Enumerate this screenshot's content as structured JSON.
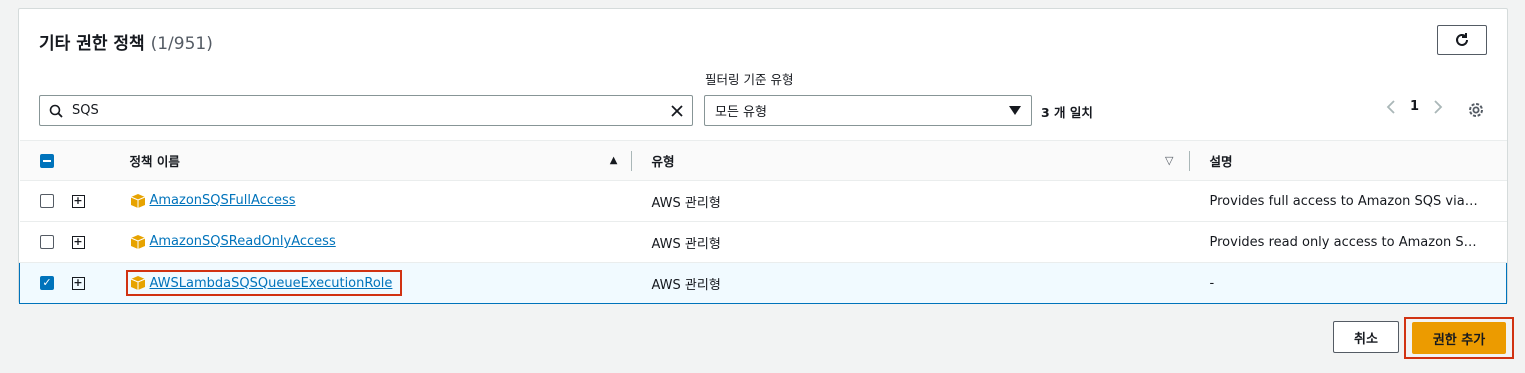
{
  "header": {
    "title": "기타 권한 정책",
    "count": "(1/951)"
  },
  "filter": {
    "label": "필터링 기준 유형",
    "search_value": "SQS",
    "type_selected": "모든 유형",
    "match_count": "3 개 일치"
  },
  "pagination": {
    "current_page": "1"
  },
  "table": {
    "columns": {
      "name": "정책 이름",
      "type": "유형",
      "description": "설명"
    },
    "rows": [
      {
        "name": "AmazonSQSFullAccess",
        "type": "AWS 관리형",
        "description": "Provides full access to Amazon SQS via the AWS Management Console.",
        "checked": false
      },
      {
        "name": "AmazonSQSReadOnlyAccess",
        "type": "AWS 관리형",
        "description": "Provides read only access to Amazon SQS via the AWS Management Console.",
        "checked": false
      },
      {
        "name": "AWSLambdaSQSQueueExecutionRole",
        "type": "AWS 관리형",
        "description": "-",
        "checked": true
      }
    ]
  },
  "footer": {
    "cancel_label": "취소",
    "add_label": "권한 추가"
  },
  "colors": {
    "accent": "#ec9b00",
    "link": "#0073bb",
    "highlight_border": "#d13212",
    "policy_icon": "#e7a300"
  },
  "icons": {
    "refresh": "refresh-icon",
    "search": "search-icon",
    "clear": "close-icon",
    "dropdown": "caret-down-icon",
    "settings": "gear-icon",
    "policy": "aws-policy-cube-icon"
  }
}
